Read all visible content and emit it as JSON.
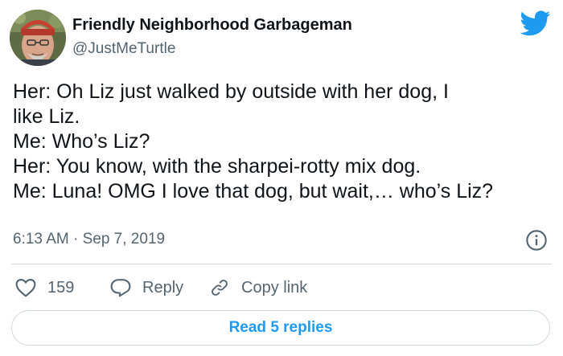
{
  "tweet": {
    "author": {
      "display_name": "Friendly Neighborhood Garbageman",
      "handle": "@JustMeTurtle"
    },
    "brand_icon": "twitter-bird-icon",
    "body_lines": [
      "Her: Oh Liz just walked by outside with her dog, I",
      "like Liz.",
      "Me:  Who’s Liz?",
      "Her: You know, with the sharpei-rotty mix dog.",
      "Me: Luna! OMG I love that dog, but wait,… who’s Liz?"
    ],
    "timestamp": "6:13 AM · Sep 7, 2019",
    "info_icon": "info-icon",
    "actions": {
      "like_count": "159",
      "reply_label": "Reply",
      "copy_link_label": "Copy link"
    },
    "read_replies_label": "Read 5 replies"
  },
  "colors": {
    "brand_blue": "#1d9bf0",
    "text_primary": "#0f1419",
    "text_secondary": "#536471",
    "border": "#cfd9de"
  }
}
